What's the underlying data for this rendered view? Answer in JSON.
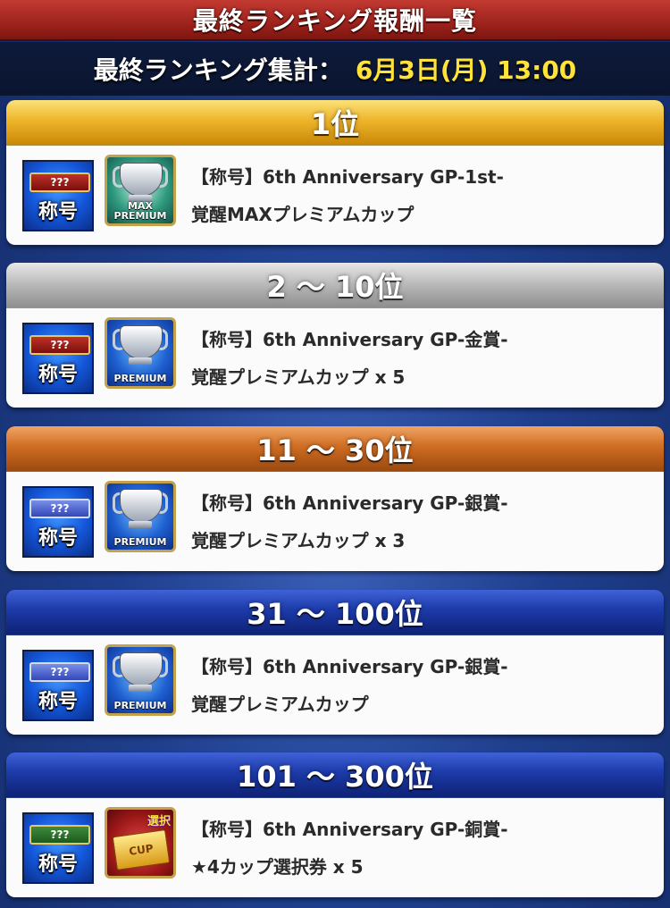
{
  "header": {
    "title": "最終ランキング報酬一覧",
    "summary_label": "最終ランキング集計：",
    "summary_date": "6月3日(月) 13:00"
  },
  "colors": {
    "title_bar": "#9e231d",
    "gold": "#eeb52a",
    "silver": "#bcbcbc",
    "bronze": "#cf6d23",
    "blue": "#1c3aa8",
    "date_text": "#ffe23a"
  },
  "ranks": [
    {
      "label": "1位",
      "header_style": "gold",
      "badge": {
        "plate_text": "???",
        "text": "称号",
        "plate_color": "red"
      },
      "item": {
        "icon": "max-premium-cup-icon",
        "caption": "MAX PREMIUM"
      },
      "lines": [
        "【称号】6th Anniversary GP-1st-",
        "覚醒MAXプレミアムカップ"
      ]
    },
    {
      "label": "2 〜 10位",
      "header_style": "silver",
      "badge": {
        "plate_text": "???",
        "text": "称号",
        "plate_color": "red"
      },
      "item": {
        "icon": "premium-cup-icon",
        "caption": "PREMIUM"
      },
      "lines": [
        "【称号】6th Anniversary GP-金賞-",
        "覚醒プレミアムカップ x 5"
      ]
    },
    {
      "label": "11 〜 30位",
      "header_style": "bronze",
      "badge": {
        "plate_text": "???",
        "text": "称号",
        "plate_color": "silver"
      },
      "item": {
        "icon": "premium-cup-icon",
        "caption": "PREMIUM"
      },
      "lines": [
        "【称号】6th Anniversary GP-銀賞-",
        "覚醒プレミアムカップ x 3"
      ]
    },
    {
      "label": "31 〜 100位",
      "header_style": "blue",
      "badge": {
        "plate_text": "???",
        "text": "称号",
        "plate_color": "silver"
      },
      "item": {
        "icon": "premium-cup-icon",
        "caption": "PREMIUM"
      },
      "lines": [
        "【称号】6th Anniversary GP-銀賞-",
        "覚醒プレミアムカップ"
      ]
    },
    {
      "label": "101 〜 300位",
      "header_style": "blue",
      "badge": {
        "plate_text": "???",
        "text": "称号",
        "plate_color": "green"
      },
      "item": {
        "icon": "cup-select-ticket-icon",
        "caption": "CUP",
        "tag": "選択"
      },
      "lines": [
        "【称号】6th Anniversary GP-銅賞-",
        "★4カップ選択券 x 5"
      ]
    }
  ]
}
